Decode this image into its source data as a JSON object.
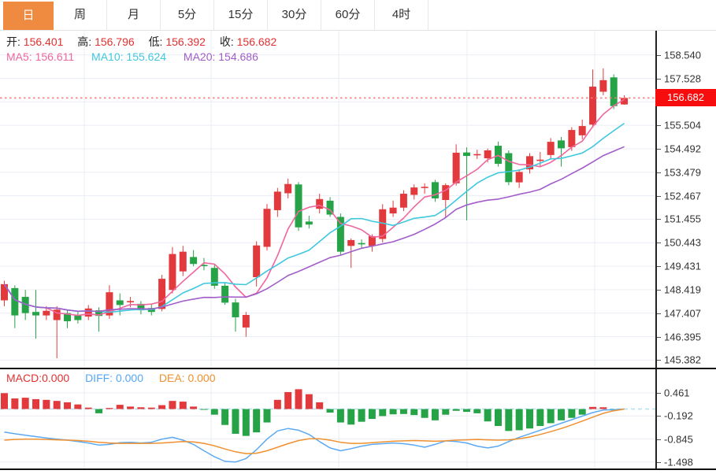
{
  "tabs": {
    "active": "日",
    "items": [
      {
        "id": "day",
        "label": "日"
      },
      {
        "id": "week",
        "label": "周"
      },
      {
        "id": "month",
        "label": "月"
      },
      {
        "id": "m5",
        "label": "5分"
      },
      {
        "id": "m15",
        "label": "15分"
      },
      {
        "id": "m30",
        "label": "30分"
      },
      {
        "id": "m60",
        "label": "60分"
      },
      {
        "id": "h4",
        "label": "4时"
      }
    ]
  },
  "quote": {
    "open_label": "开:",
    "open": "156.401",
    "high_label": "高:",
    "high": "156.796",
    "low_label": "低:",
    "low": "156.392",
    "close_label": "收:",
    "close": "156.682"
  },
  "ma": {
    "ma5_label": "MA5:",
    "ma5": "156.611",
    "ma10_label": "MA10:",
    "ma10": "155.624",
    "ma20_label": "MA20:",
    "ma20": "154.686"
  },
  "price_axis": {
    "tag": "156.682",
    "labels": [
      "158.540",
      "157.528",
      "156.516",
      "155.504",
      "154.492",
      "153.479",
      "152.467",
      "151.455",
      "150.443",
      "149.431",
      "148.419",
      "147.407",
      "146.395",
      "145.382"
    ]
  },
  "macd_panel": {
    "macd_label": "MACD:",
    "macd": "0.000",
    "diff_label": "DIFF:",
    "diff": "0.000",
    "dea_label": "DEA:",
    "dea": "0.000",
    "axis_labels": [
      "0.461",
      "-0.192",
      "-0.845",
      "-1.498"
    ]
  },
  "colors": {
    "up": "#e23a3c",
    "down": "#26a347",
    "ma5": "#f0669e",
    "ma10": "#3fc8de",
    "ma20": "#a25dc9",
    "diff_line": "#5ca9f2",
    "dea_line": "#f0902f",
    "grid": "#e9edf4",
    "dotted_last_price": "#fa7a7a",
    "tag_bg": "#f70d0d",
    "active_tab": "#ef8b40",
    "macd_zero_dash": "#b3e0f0"
  },
  "chart_data": {
    "type": "candlestick",
    "interval": "日",
    "title": "",
    "y_axis": {
      "min": 145.0,
      "max": 159.3,
      "ticks": [
        158.54,
        157.528,
        156.516,
        155.504,
        154.492,
        153.479,
        152.467,
        151.455,
        150.443,
        149.431,
        148.419,
        147.407,
        146.395,
        145.382
      ]
    },
    "last_price": 156.682,
    "overlays": [
      {
        "name": "MA5",
        "period": 5,
        "value": 156.611
      },
      {
        "name": "MA10",
        "period": 10,
        "value": 155.624
      },
      {
        "name": "MA20",
        "period": 20,
        "value": 154.686
      }
    ],
    "candles": [
      [
        147.95,
        148.8,
        147.7,
        148.65
      ],
      [
        148.48,
        148.6,
        146.75,
        147.3
      ],
      [
        148.1,
        148.4,
        147.1,
        147.4
      ],
      [
        147.45,
        148.4,
        146.3,
        147.3
      ],
      [
        147.3,
        147.7,
        147.1,
        147.5
      ],
      [
        147.1,
        147.7,
        145.45,
        147.55
      ],
      [
        147.4,
        147.55,
        146.75,
        147.05
      ],
      [
        147.3,
        147.45,
        146.95,
        147.1
      ],
      [
        147.25,
        147.75,
        147.1,
        147.6
      ],
      [
        147.52,
        147.65,
        146.6,
        147.28
      ],
      [
        147.3,
        148.6,
        147.15,
        148.3
      ],
      [
        147.95,
        148.25,
        147.3,
        147.75
      ],
      [
        147.9,
        148.1,
        147.65,
        147.92
      ],
      [
        147.8,
        147.92,
        147.35,
        147.52
      ],
      [
        147.62,
        147.78,
        147.3,
        147.45
      ],
      [
        147.58,
        149.05,
        147.48,
        148.88
      ],
      [
        148.4,
        150.25,
        148.25,
        149.95
      ],
      [
        149.2,
        150.3,
        149.0,
        150.05
      ],
      [
        149.82,
        150.12,
        149.42,
        149.52
      ],
      [
        149.48,
        149.78,
        149.25,
        149.46
      ],
      [
        149.35,
        149.52,
        148.45,
        148.58
      ],
      [
        148.58,
        148.72,
        147.76,
        147.85
      ],
      [
        147.86,
        148.02,
        146.6,
        147.22
      ],
      [
        146.78,
        147.45,
        146.38,
        147.32
      ],
      [
        148.95,
        150.5,
        148.55,
        150.32
      ],
      [
        150.26,
        152.1,
        150.1,
        151.9
      ],
      [
        151.84,
        152.8,
        151.55,
        152.64
      ],
      [
        152.57,
        153.2,
        152.35,
        152.97
      ],
      [
        152.95,
        153.05,
        150.95,
        151.1
      ],
      [
        151.35,
        151.6,
        151.05,
        151.22
      ],
      [
        151.9,
        152.55,
        151.7,
        152.32
      ],
      [
        152.25,
        152.4,
        151.55,
        151.65
      ],
      [
        151.55,
        151.7,
        149.9,
        150.05
      ],
      [
        150.3,
        150.62,
        149.35,
        150.55
      ],
      [
        150.42,
        150.58,
        150.22,
        150.4
      ],
      [
        150.3,
        150.8,
        150.05,
        150.72
      ],
      [
        150.6,
        152.1,
        150.45,
        151.88
      ],
      [
        151.7,
        152.25,
        151.55,
        151.95
      ],
      [
        151.95,
        152.7,
        151.8,
        152.55
      ],
      [
        152.5,
        152.95,
        152.3,
        152.82
      ],
      [
        152.8,
        153.0,
        152.55,
        152.85
      ],
      [
        153.05,
        153.15,
        152.2,
        152.35
      ],
      [
        152.28,
        153.0,
        151.5,
        152.92
      ],
      [
        153.0,
        154.68,
        152.9,
        154.32
      ],
      [
        154.33,
        154.55,
        151.4,
        154.18
      ],
      [
        154.25,
        154.45,
        154.05,
        154.26
      ],
      [
        154.08,
        154.5,
        153.9,
        154.42
      ],
      [
        154.62,
        154.8,
        153.72,
        153.84
      ],
      [
        154.3,
        154.42,
        152.92,
        153.05
      ],
      [
        153.04,
        153.6,
        152.8,
        153.49
      ],
      [
        153.6,
        154.3,
        153.42,
        154.17
      ],
      [
        154.0,
        154.35,
        153.7,
        154.02
      ],
      [
        154.22,
        154.95,
        154.05,
        154.79
      ],
      [
        154.85,
        155.0,
        153.72,
        154.51
      ],
      [
        154.56,
        155.42,
        154.4,
        155.3
      ],
      [
        155.07,
        155.75,
        154.9,
        155.47
      ],
      [
        155.53,
        157.91,
        155.4,
        157.17
      ],
      [
        156.95,
        157.96,
        156.8,
        157.45
      ],
      [
        157.57,
        157.7,
        156.2,
        156.33
      ],
      [
        156.401,
        156.796,
        156.392,
        156.682
      ]
    ],
    "macd": {
      "axis_ticks": [
        0.461,
        -0.192,
        -0.845,
        -1.498
      ],
      "last": {
        "macd": 0.0,
        "diff": 0.0,
        "dea": 0.0
      },
      "hist": [
        0.45,
        0.3,
        0.32,
        0.28,
        0.26,
        0.23,
        0.19,
        0.13,
        0.04,
        -0.12,
        0.03,
        0.12,
        0.07,
        0.05,
        0.04,
        0.11,
        0.23,
        0.21,
        0.07,
        -0.02,
        -0.16,
        -0.45,
        -0.7,
        -0.76,
        -0.66,
        -0.38,
        0.26,
        0.48,
        0.56,
        0.42,
        0.19,
        -0.1,
        -0.38,
        -0.44,
        -0.36,
        -0.28,
        -0.2,
        -0.15,
        -0.14,
        -0.17,
        -0.25,
        -0.32,
        -0.16,
        -0.05,
        -0.08,
        -0.12,
        -0.35,
        -0.48,
        -0.62,
        -0.6,
        -0.55,
        -0.48,
        -0.4,
        -0.32,
        -0.25,
        -0.16,
        0.06,
        0.05,
        -0.04,
        0.0
      ],
      "diff": [
        -0.65,
        -0.7,
        -0.74,
        -0.78,
        -0.82,
        -0.85,
        -0.88,
        -0.92,
        -0.96,
        -1.02,
        -1.0,
        -0.95,
        -0.94,
        -0.96,
        -0.94,
        -0.85,
        -0.8,
        -0.88,
        -1.0,
        -1.18,
        -1.35,
        -1.48,
        -1.5,
        -1.4,
        -1.15,
        -0.85,
        -0.62,
        -0.55,
        -0.6,
        -0.72,
        -0.92,
        -1.1,
        -1.18,
        -1.12,
        -1.05,
        -1.0,
        -0.98,
        -0.96,
        -0.98,
        -1.02,
        -1.08,
        -1.0,
        -0.9,
        -0.92,
        -0.96,
        -1.05,
        -1.1,
        -1.05,
        -0.92,
        -0.8,
        -0.7,
        -0.6,
        -0.5,
        -0.4,
        -0.3,
        -0.2,
        -0.1,
        -0.03,
        -0.02,
        0.0
      ],
      "dea": [
        -0.88,
        -0.86,
        -0.85,
        -0.85,
        -0.86,
        -0.87,
        -0.88,
        -0.89,
        -0.91,
        -0.94,
        -0.96,
        -0.97,
        -0.97,
        -0.97,
        -0.97,
        -0.96,
        -0.94,
        -0.92,
        -0.93,
        -0.97,
        -1.04,
        -1.13,
        -1.21,
        -1.26,
        -1.25,
        -1.18,
        -1.08,
        -0.98,
        -0.89,
        -0.84,
        -0.84,
        -0.88,
        -0.94,
        -0.97,
        -0.97,
        -0.95,
        -0.93,
        -0.91,
        -0.9,
        -0.89,
        -0.9,
        -0.91,
        -0.9,
        -0.88,
        -0.87,
        -0.86,
        -0.87,
        -0.88,
        -0.87,
        -0.84,
        -0.79,
        -0.72,
        -0.64,
        -0.55,
        -0.45,
        -0.34,
        -0.23,
        -0.12,
        -0.05,
        0.0
      ]
    }
  }
}
